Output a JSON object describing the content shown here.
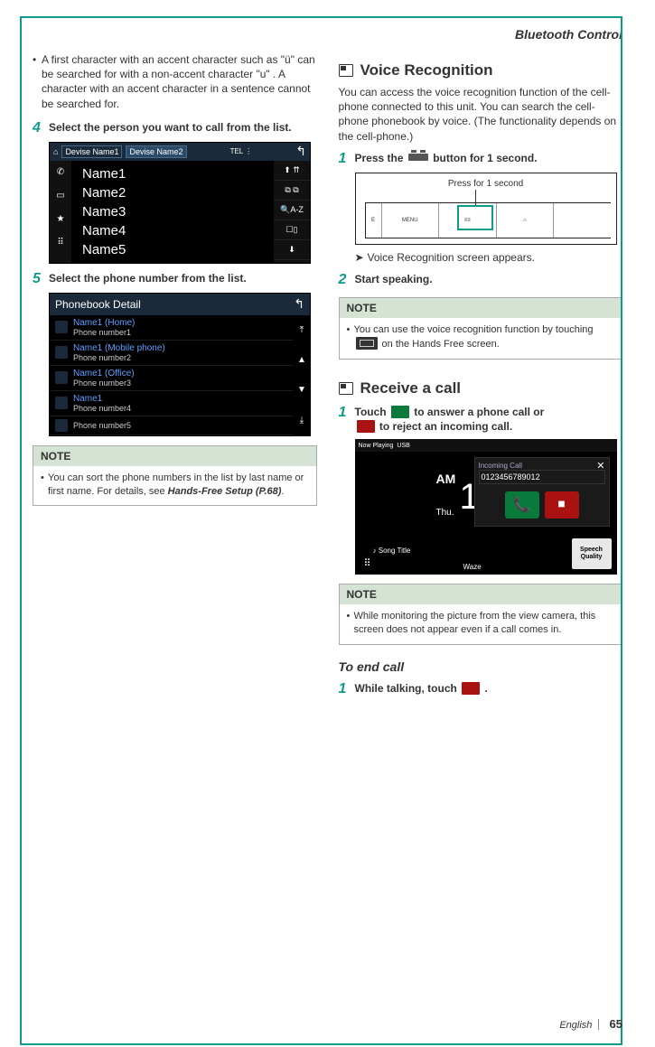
{
  "header": {
    "title": "Bluetooth Control"
  },
  "left": {
    "bullet1": "A first character with an accent character such as \"ü\" can be searched for with a non-accent character \"u\" . A character with an accent character in a sentence cannot be searched for.",
    "step4": {
      "num": "4",
      "text": "Select the person you want to call from the list."
    },
    "fig1": {
      "tab1": "Devise Name1",
      "tab2": "Devise Name2",
      "names": [
        "Name1",
        "Name2",
        "Name3",
        "Name4",
        "Name5"
      ],
      "right_az": "A-Z"
    },
    "step5": {
      "num": "5",
      "text": "Select the phone number from the list."
    },
    "fig2": {
      "title": "Phonebook Detail",
      "rows": [
        {
          "l1": "Name1 (Home)",
          "l2": "Phone number1"
        },
        {
          "l1": "Name1 (Mobile phone)",
          "l2": "Phone number2"
        },
        {
          "l1": "Name1 (Office)",
          "l2": "Phone number3"
        },
        {
          "l1": "Name1",
          "l2": "Phone number4"
        },
        {
          "l1": "",
          "l2": "Phone number5"
        }
      ]
    },
    "note1": {
      "head": "NOTE",
      "body_pre": "You can sort the phone numbers in the list by last name or first name. For details, see ",
      "body_ref": "Hands-Free Setup (P.68)",
      "body_post": "."
    }
  },
  "right": {
    "voice": {
      "title": "Voice Recognition",
      "para": "You can access the voice recognition function of the cell-phone connected to this unit. You can search the cell-phone phonebook by voice. (The functionality depends on the cell-phone.)",
      "step1": {
        "num": "1",
        "pre": "Press the ",
        "post": " button for 1 second."
      },
      "fig_label": "Press for 1 second",
      "fig_btn": "MENU",
      "arrow": "Voice Recognition screen appears.",
      "step2": {
        "num": "2",
        "text": "Start speaking."
      },
      "note": {
        "head": "NOTE",
        "pre": "You can use the voice recognition function by touching ",
        "post": " on the Hands Free screen."
      }
    },
    "receive": {
      "title": "Receive a call",
      "step1": {
        "num": "1",
        "pre": "Touch ",
        "mid": " to answer a phone call or ",
        "post": " to reject an incoming call."
      },
      "fig": {
        "usb": "USB",
        "now": "Now Playing",
        "am": "AM",
        "one": "1",
        "thu": "Thu.",
        "song": "Song Title",
        "waze": "Waze",
        "popup_title": "Incoming Call",
        "popup_number": "0123456789012",
        "sq": "Speech Quality"
      },
      "note": {
        "head": "NOTE",
        "text": "While monitoring the picture from the view camera, this screen does not appear even if a call comes in."
      }
    },
    "end": {
      "title": "To end call",
      "step1": {
        "num": "1",
        "pre": "While talking, touch ",
        "post": " ."
      }
    }
  },
  "footer": {
    "lang": "English",
    "page": "65"
  }
}
